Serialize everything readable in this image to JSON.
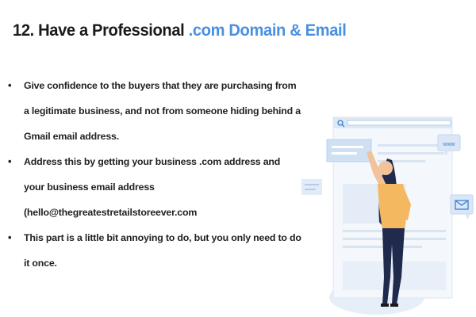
{
  "slide": {
    "title_prefix": "12. Have a Professional ",
    "title_accent": ".com Domain & Email",
    "bullets": [
      "Give confidence to the buyers that they are purchasing from a legitimate business, and not from someone hiding behind a Gmail email address.",
      "Address this by getting your business .com address and your business email address (hello@thegreatestretailstoreever.com",
      "This part is a little bit annoying to do, but you only need to do it once."
    ]
  },
  "illustration": {
    "www_label": "www",
    "icons": [
      "search-icon",
      "www-icon",
      "mail-icon"
    ]
  },
  "colors": {
    "accent": "#4a90e2",
    "title_text": "#1a1a1a",
    "body_text": "#222222",
    "illustration_blue": "#cfe0f3",
    "shirt": "#f4b860",
    "pants": "#1f2a4d"
  }
}
